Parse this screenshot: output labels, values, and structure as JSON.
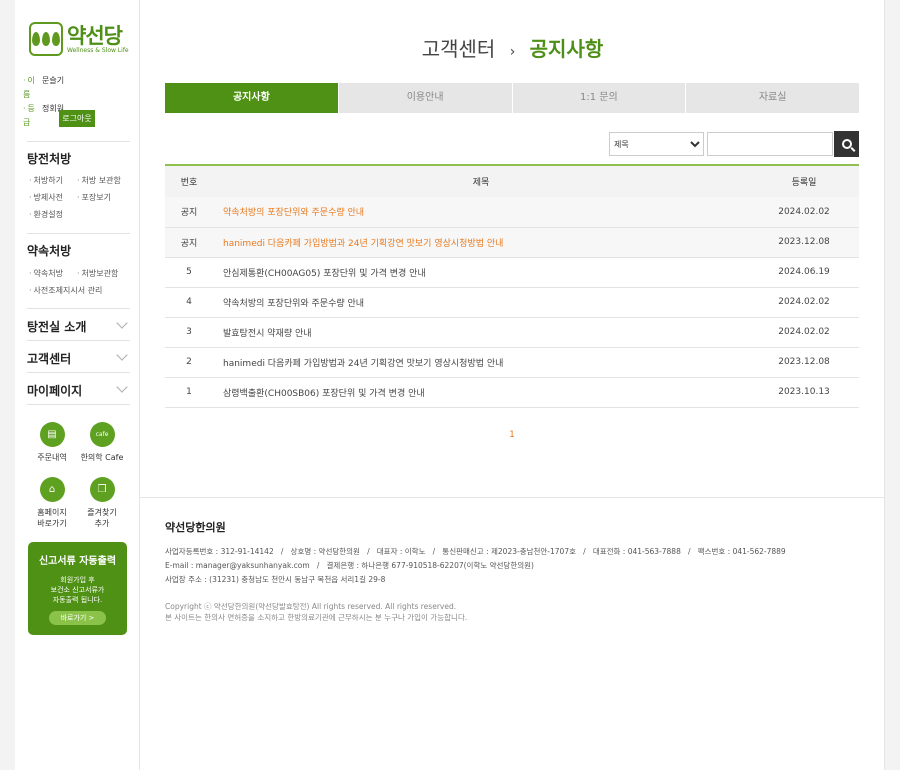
{
  "brand": {
    "name_kr": "약선당",
    "name_en": "Wellness & Slow Life"
  },
  "user": {
    "name_label": "이름",
    "name": "문슬기",
    "grade_label": "등급",
    "grade": "정회원",
    "logout": "로그아웃"
  },
  "sidebar": {
    "section1": {
      "title": "탕전처방",
      "items": [
        "처방하기",
        "처방 보관함",
        "방제사전",
        "포장보기",
        "환경설정"
      ]
    },
    "section2": {
      "title": "약속처방",
      "items": [
        "약속처방",
        "처방보관함",
        "사전조제지시서 관리"
      ]
    },
    "collapsed": [
      "탕전실 소개",
      "고객센터",
      "마이페이지"
    ],
    "quick": [
      {
        "label": "주문내역",
        "icon": "document-icon"
      },
      {
        "label": "한의학 Cafe",
        "icon": "cafe-icon"
      },
      {
        "label": "홈페이지\n바로가기",
        "icon": "home-icon"
      },
      {
        "label": "즐겨찾기\n추가",
        "icon": "bookmark-icon"
      }
    ],
    "promo": {
      "title": "신고서류 자동출력",
      "text": "회원가입 후\n보건소 신고서류가\n자동출력 됩니다.",
      "button": "바로가기  >"
    }
  },
  "header": {
    "parent": "고객센터",
    "separator": "›",
    "current": "공지사항"
  },
  "tabs": [
    "공지사항",
    "이용안내",
    "1:1 문의",
    "자료실"
  ],
  "search": {
    "select_value": "제목",
    "input_value": ""
  },
  "table": {
    "headers": [
      "번호",
      "제목",
      "등록일"
    ],
    "rows": [
      {
        "num": "공지",
        "title": "약속처방의 포장단위와 주문수량 안내",
        "date": "2024.02.02",
        "notice": true
      },
      {
        "num": "공지",
        "title": "hanimedi 다음카페 가입방법과 24년 기획강연 맛보기 영상시청방법 안내",
        "date": "2023.12.08",
        "notice": true
      },
      {
        "num": "5",
        "title": "안심제통환(CH00AG05) 포장단위 및 가격 변경 안내",
        "date": "2024.06.19",
        "notice": false
      },
      {
        "num": "4",
        "title": "약속처방의 포장단위와 주문수량 안내",
        "date": "2024.02.02",
        "notice": false
      },
      {
        "num": "3",
        "title": "발효탕전시 약재량 안내",
        "date": "2024.02.02",
        "notice": false
      },
      {
        "num": "2",
        "title": "hanimedi 다음카페 가입방법과 24년 기획강연 맛보기 영상시청방법 안내",
        "date": "2023.12.08",
        "notice": false
      },
      {
        "num": "1",
        "title": "삼령백출환(CH00SB06) 포장단위 및 가격 변경 안내",
        "date": "2023.10.13",
        "notice": false
      }
    ]
  },
  "pagination": {
    "current": "1"
  },
  "footer": {
    "title": "약선당한의원",
    "line1": "사업자등록번호 : 312-91-14142   /   상호명 : 약선당한의원   /   대표자 : 이학노   /   통신판매신고 : 제2023-충남천안-1707호   /   대표전화 : 041-563-7888   /   팩스번호 : 041-562-7889",
    "line2": "E-mail : manager@yaksunhanyak.com   /   결제은행 : 하나은행 677-910518-62207(이학노 약선당한의원)",
    "line3": "사업장 주소 : (31231) 충청남도 천안시 동남구 목천읍 서리1길 29-8",
    "copyright": "Copyright ⓒ 약선당한의원(약선당발효탕전) All rights reserved. All rights reserved.",
    "notice": "본 사이트는 한의사 면허증을 소지하고 한방의료기관에 근무하시는 분 누구나 가입이 가능합니다."
  }
}
